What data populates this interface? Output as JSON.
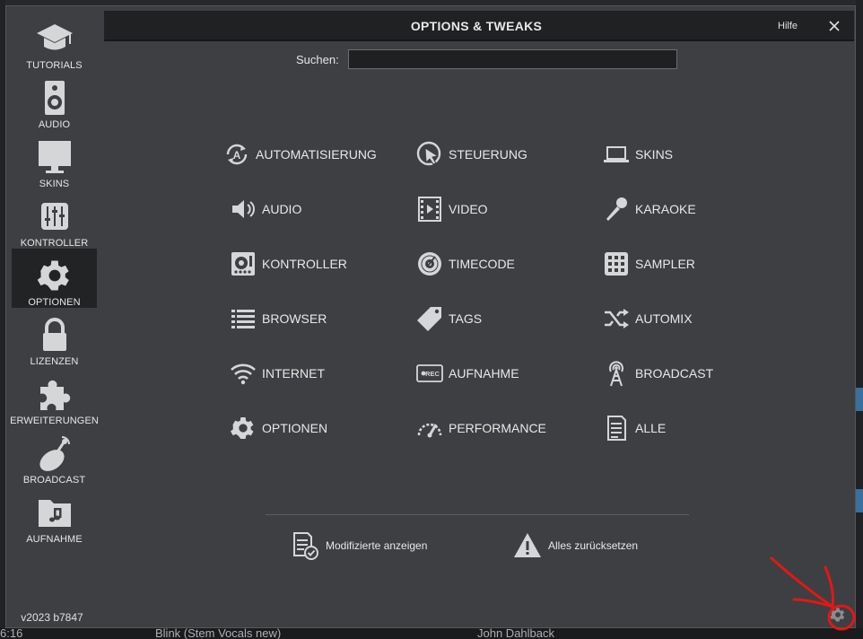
{
  "background_app": {
    "bottom_row": {
      "time": "6:16",
      "title": "Blink (Stem Vocals new)",
      "artist": "John Dahlback"
    }
  },
  "dialog": {
    "title": "OPTIONS & TWEAKS",
    "help_label": "Hilfe",
    "search": {
      "label": "Suchen:",
      "value": "",
      "placeholder": ""
    },
    "version": "v2023 b7847"
  },
  "sidebar": {
    "items": [
      {
        "label": "TUTORIALS",
        "icon": "graduation-cap-icon",
        "active": false
      },
      {
        "label": "AUDIO",
        "icon": "speaker-icon",
        "active": false
      },
      {
        "label": "SKINS",
        "icon": "monitor-icon",
        "active": false
      },
      {
        "label": "KONTROLLER",
        "icon": "mixer-faders-icon",
        "active": false
      },
      {
        "label": "OPTIONEN",
        "icon": "gear-icon",
        "active": true
      },
      {
        "label": "LIZENZEN",
        "icon": "lock-icon",
        "active": false
      },
      {
        "label": "ERWEITERUNGEN",
        "icon": "puzzle-icon",
        "active": false
      },
      {
        "label": "BROADCAST",
        "icon": "satellite-dish-icon",
        "active": false
      },
      {
        "label": "AUFNAHME",
        "icon": "music-folder-icon",
        "active": false
      }
    ]
  },
  "options": {
    "col1": [
      {
        "label": "AUTOMATISIERUNG",
        "icon": "automation-icon"
      },
      {
        "label": "AUDIO",
        "icon": "volume-icon"
      },
      {
        "label": "KONTROLLER",
        "icon": "controller-icon"
      },
      {
        "label": "BROWSER",
        "icon": "list-icon"
      },
      {
        "label": "INTERNET",
        "icon": "wifi-icon"
      },
      {
        "label": "OPTIONEN",
        "icon": "gear-icon"
      }
    ],
    "col2": [
      {
        "label": "STEUERUNG",
        "icon": "cursor-icon"
      },
      {
        "label": "VIDEO",
        "icon": "film-icon"
      },
      {
        "label": "TIMECODE",
        "icon": "vinyl-icon"
      },
      {
        "label": "TAGS",
        "icon": "tag-icon"
      },
      {
        "label": "AUFNAHME",
        "icon": "rec-icon"
      },
      {
        "label": "PERFORMANCE",
        "icon": "gauge-icon"
      }
    ],
    "col3": [
      {
        "label": "SKINS",
        "icon": "laptop-icon"
      },
      {
        "label": "KARAOKE",
        "icon": "microphone-icon"
      },
      {
        "label": "SAMPLER",
        "icon": "grid-icon"
      },
      {
        "label": "AUTOMIX",
        "icon": "shuffle-icon"
      },
      {
        "label": "BROADCAST",
        "icon": "antenna-icon"
      },
      {
        "label": "ALLE",
        "icon": "document-icon"
      }
    ]
  },
  "footer": {
    "show_modified": "Modifizierte anzeigen",
    "reset_all": "Alles zurücksetzen"
  },
  "colors": {
    "dialog_bg": "#3e3f42",
    "titlebar_bg": "#202123",
    "text": "#e8e8e8",
    "icon": "#d4d6d8",
    "annotation": "#e01818"
  }
}
